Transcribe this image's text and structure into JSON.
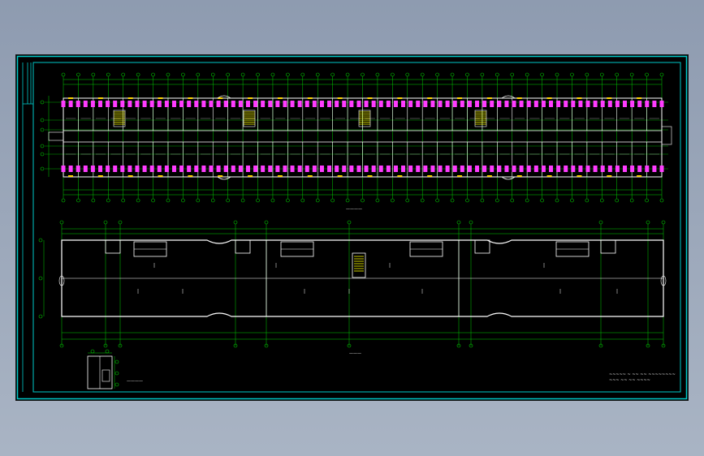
{
  "viewer": {
    "background_top": "#8e9bb0",
    "background_bottom": "#a9b4c4",
    "sheet_color": "#000000"
  },
  "colors": {
    "frame": "#00c8c8",
    "grid": "#00d000",
    "walls": "#ffffff",
    "columns": "#ff3cff",
    "doors": "#ffd700",
    "stairs": "#ffff00"
  },
  "drawing": {
    "plan_caption": "————",
    "roof_caption": "———",
    "detail_caption": "————",
    "titleblock_line1": "~~~~~ ~ ~~ ~~ ~~~~~~~~",
    "titleblock_line2": "~~~ ~~ ~~ ~~~~"
  }
}
